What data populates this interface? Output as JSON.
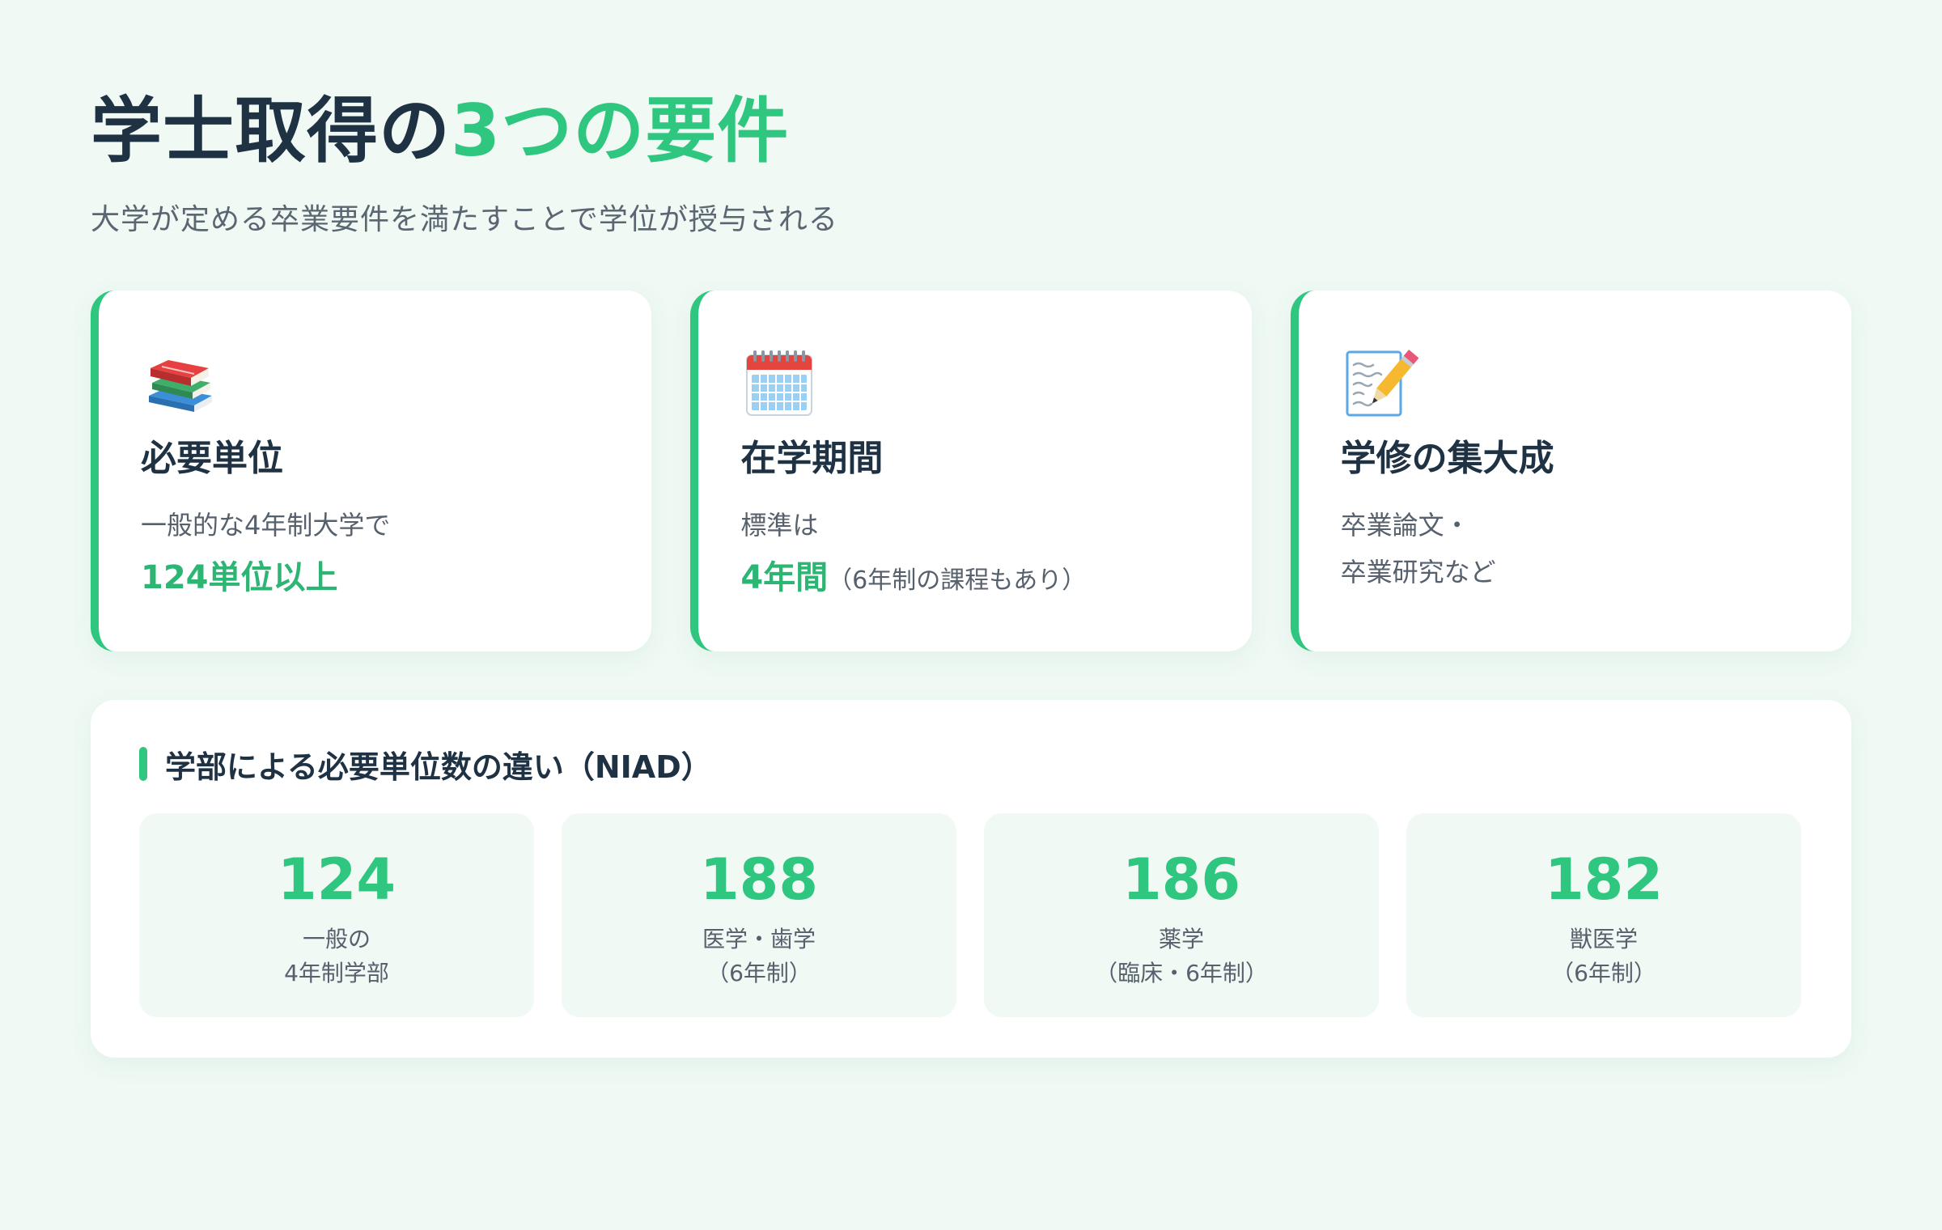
{
  "header": {
    "title_main": "学士取得の",
    "title_accent": "3つの要件",
    "subtitle": "大学が定める卒業要件を満たすことで学位が授与される"
  },
  "colors": {
    "accent": "#2fc77f",
    "background": "#f0f9f4",
    "text_dark": "#1f3244"
  },
  "cards": [
    {
      "icon": "books-icon",
      "title": "必要単位",
      "text": "一般的な4年制大学で",
      "highlight": "124単位以上",
      "note": ""
    },
    {
      "icon": "calendar-icon",
      "title": "在学期間",
      "text": "標準は",
      "highlight": "4年間",
      "note": "（6年制の課程もあり）"
    },
    {
      "icon": "memo-pencil-icon",
      "title": "学修の集大成",
      "text": "卒業論文・",
      "text2": "卒業研究など"
    }
  ],
  "panel": {
    "heading": "学部による必要単位数の違い（NIAD）",
    "stats": [
      {
        "value": "124",
        "label1": "一般の",
        "label2": "4年制学部"
      },
      {
        "value": "188",
        "label1": "医学・歯学",
        "label2": "（6年制）"
      },
      {
        "value": "186",
        "label1": "薬学",
        "label2": "（臨床・6年制）"
      },
      {
        "value": "182",
        "label1": "獣医学",
        "label2": "（6年制）"
      }
    ]
  }
}
